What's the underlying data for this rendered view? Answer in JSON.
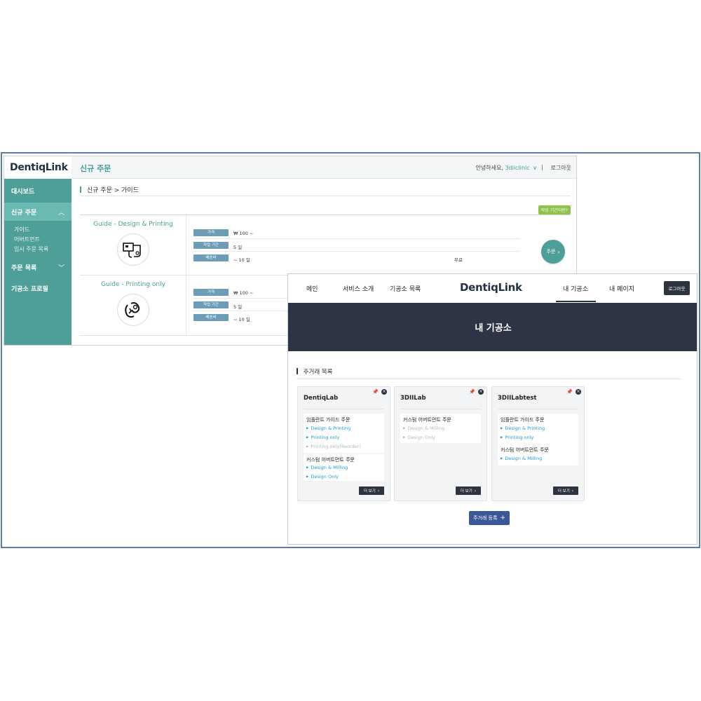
{
  "admin": {
    "logo": "DentiqLink",
    "title": "신규 주문",
    "greeting": "안녕하세요,",
    "user": "3diiclinic",
    "logout": "로그아웃",
    "sidebar": {
      "dashboard": "대시보드",
      "new_order": "신규 주문",
      "sub_items": [
        "가이드",
        "어버트먼트",
        "임시 주문 목록"
      ],
      "order_list": "주문 목록",
      "lab_profile": "기공소 프로필"
    },
    "breadcrumb": {
      "parent": "신규 주문",
      "current": "가이드"
    },
    "badge": "작업 기간이란?",
    "products": [
      {
        "title": "Guide - Design & Printing",
        "icon": "guide-design-printing-icon",
        "specs": [
          {
            "label": "가격",
            "value": "₩ 100 ~",
            "extra": ""
          },
          {
            "label": "작업 기간",
            "value": "5 일",
            "extra": ""
          },
          {
            "label": "배송비",
            "value": "~ 10 일",
            "extra": "무료"
          }
        ],
        "order": "주문"
      },
      {
        "title": "Guide - Printing only",
        "icon": "guide-printing-icon",
        "specs": [
          {
            "label": "가격",
            "value": "₩ 100 ~"
          },
          {
            "label": "작업 기간",
            "value": "5 일"
          },
          {
            "label": "배송비",
            "value": "~ 10 일"
          }
        ]
      }
    ]
  },
  "client": {
    "nav": [
      "메인",
      "서비스 소개",
      "기공소 목록",
      "내 기공소",
      "내 페이지"
    ],
    "logo": "DentiqLink",
    "logout": "로그아웃",
    "hero": "내 기공소",
    "section_title": "주거래 목록",
    "cards": [
      {
        "name": "DentiqLab",
        "groups": [
          {
            "title": "임플란트 가이드 주문",
            "options": [
              {
                "text": "Design & Printing",
                "enabled": true
              },
              {
                "text": "Printing only",
                "enabled": true
              },
              {
                "text": "Printing only(Reorder)",
                "enabled": false
              }
            ]
          },
          {
            "title": "커스텀 어버트먼트 주문",
            "options": [
              {
                "text": "Design & Milling",
                "enabled": true
              },
              {
                "text": "Design Only",
                "enabled": true
              }
            ]
          }
        ],
        "more": "더 보기"
      },
      {
        "name": "3DIILab",
        "groups": [
          {
            "title": "커스텀 어버트먼트 주문",
            "options": [
              {
                "text": "Design & Milling",
                "enabled": false
              },
              {
                "text": "Design Only",
                "enabled": false
              }
            ]
          }
        ],
        "more": "더 보기"
      },
      {
        "name": "3DIILabtest",
        "groups": [
          {
            "title": "임플란트 가이드 주문",
            "options": [
              {
                "text": "Design & Printing",
                "enabled": true
              },
              {
                "text": "Printing only",
                "enabled": true
              }
            ]
          },
          {
            "title": "커스텀 어버트먼트 주문",
            "options": [
              {
                "text": "Design & Milling",
                "enabled": true
              }
            ]
          }
        ],
        "more": "더 보기"
      }
    ],
    "add_button": "주거래 등록",
    "add_icon": "+"
  },
  "colors": {
    "teal": "#4e9f97",
    "navy": "#2e3443",
    "link_blue": "#1f9ad7",
    "button_blue": "#3b5798",
    "badge_green": "#8ec24a",
    "frame_border": "#5b7fa4"
  }
}
